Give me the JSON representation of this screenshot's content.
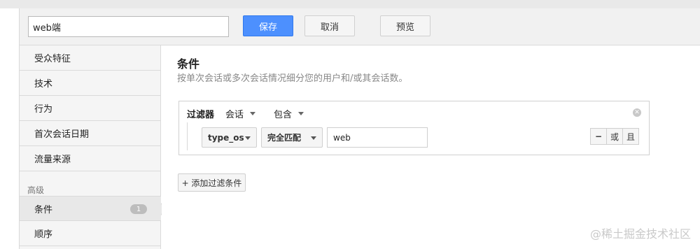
{
  "header": {
    "segment_name": "web端",
    "save_label": "保存",
    "cancel_label": "取消",
    "preview_label": "预览"
  },
  "sidebar": {
    "items": [
      {
        "label": "受众特征"
      },
      {
        "label": "技术"
      },
      {
        "label": "行为"
      },
      {
        "label": "首次会话日期"
      },
      {
        "label": "流量来源"
      }
    ],
    "section_label": "高级",
    "advanced_items": [
      {
        "label": "条件",
        "badge": "1",
        "active": true
      },
      {
        "label": "顺序"
      }
    ]
  },
  "main": {
    "title": "条件",
    "subtitle": "按单次会话或多次会话情况细分您的用户和/或其会话数。",
    "filter": {
      "label": "过滤器",
      "scope": "会话",
      "mode": "包含",
      "row": {
        "dimension": "type_os",
        "match_type": "完全匹配",
        "value": "web",
        "minus_label": "−",
        "or_label": "或",
        "and_label": "且"
      }
    },
    "add_filter_label": "+ 添加过滤条件"
  },
  "watermark": "@稀土掘金技术社区",
  "colors": {
    "primary_button": "#4d90fe",
    "sidebar_bg": "#f5f5f5",
    "header_bg": "#f1f1f1"
  }
}
